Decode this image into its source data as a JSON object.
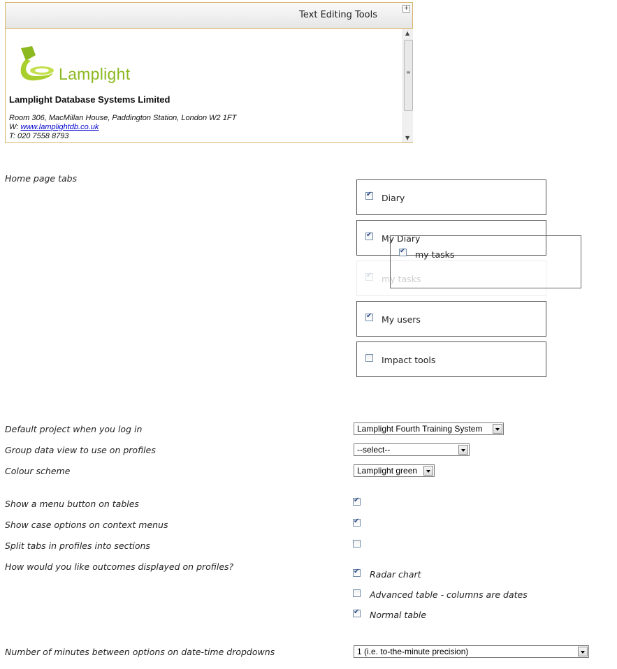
{
  "editor": {
    "title": "Text Editing Tools",
    "plus": "+",
    "signature": {
      "logo_text": "Lamplight",
      "company": "Lamplight Database Systems Limited",
      "address": "Room 306, MacMillan House, Paddington Station, London W2 1FT",
      "web_prefix": "W: ",
      "web_link": "www.lamplightdb.co.uk",
      "phone": "T: 020 7558 8793"
    }
  },
  "home_tabs": {
    "label": "Home page tabs",
    "tabs": [
      {
        "label": "Diary",
        "checked": true
      },
      {
        "label": "My Diary",
        "checked": true
      },
      {
        "label": "my tasks",
        "checked": true
      },
      {
        "label": "My users",
        "checked": true
      },
      {
        "label": "Impact tools",
        "checked": false
      }
    ],
    "dragging": {
      "label": "my tasks",
      "checked": true
    }
  },
  "settings": {
    "default_project": {
      "label": "Default project when you log in",
      "value": "Lamplight Fourth Training System"
    },
    "group_view": {
      "label": "Group data view to use on profiles",
      "value": "--select--"
    },
    "colour_scheme": {
      "label": "Colour scheme",
      "value": "Lamplight green"
    },
    "menu_button": {
      "label": "Show a menu button on tables",
      "checked": true
    },
    "case_options": {
      "label": "Show case options on context menus",
      "checked": true
    },
    "split_tabs": {
      "label": "Split tabs in profiles into sections",
      "checked": false
    },
    "outcomes": {
      "label": "How would you like outcomes displayed on profiles?",
      "options": [
        {
          "label": "Radar chart",
          "checked": true
        },
        {
          "label": "Advanced table - columns are dates",
          "checked": false
        },
        {
          "label": "Normal table",
          "checked": true
        }
      ]
    },
    "minutes": {
      "label": "Number of minutes between options on date-time dropdowns",
      "value": "1 (i.e. to-the-minute precision)"
    }
  }
}
